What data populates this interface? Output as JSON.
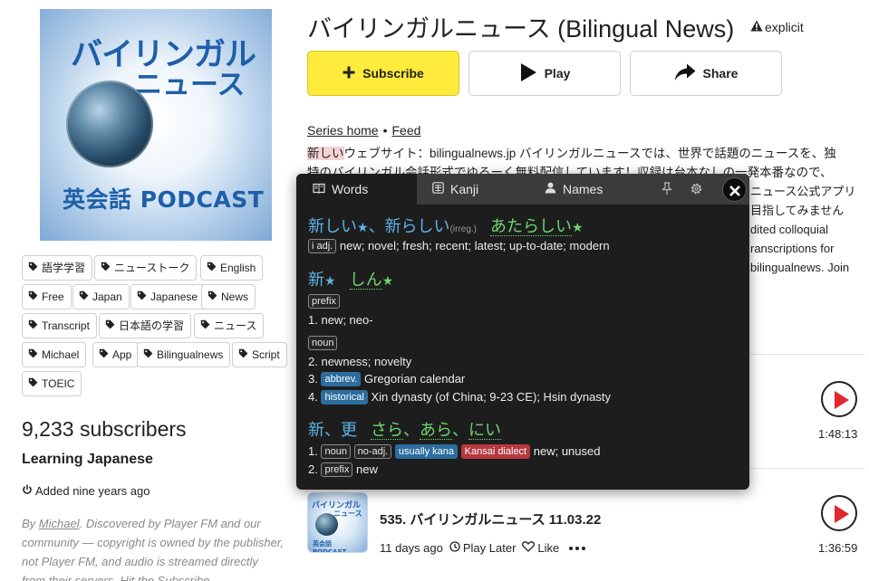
{
  "cover": {
    "line1": "バイリンガル",
    "line2": "ニュース",
    "line3": "英会話 PODCAST"
  },
  "tags": [
    "語学学習",
    "ニューストーク",
    "English",
    "Free",
    "Japan",
    "Japanese",
    "News",
    "Transcript",
    "日本語の学習",
    "ニュース",
    "Michael",
    "App",
    "Bilingualnews",
    "Script",
    "TOEIC"
  ],
  "sidebar": {
    "subscribers": "9,233 subscribers",
    "category": "Learning Japanese",
    "added": "Added nine years ago",
    "disclaimer_by": "By ",
    "disclaimer_author": "Michael",
    "disclaimer_rest": ". Discovered by Player FM and our community — copyright is owned by the publisher, not Player FM, and audio is streamed directly from their servers. Hit the Subscribe"
  },
  "header": {
    "title": "バイリンガルニュース (Bilingual News)",
    "explicit": "explicit"
  },
  "actions": {
    "subscribe": "Subscribe",
    "play": "Play",
    "share": "Share"
  },
  "links": {
    "series_home": "Series home",
    "feed": "Feed"
  },
  "description": {
    "highlight": "新しい",
    "line1_rest": "ウェブサイト：bilingualnews.jp バイリンガルニュースでは、世界で話題のニュースを、独",
    "line2": "特のバイリンガル会話形式でゆるーく無料配信しています！収録は台本なしの一発本番なので、",
    "right_lines": [
      "ニュース公式アプリ",
      "目指してみません",
      "dited colloquial",
      "ranscriptions for",
      "bilingualnews. Join"
    ]
  },
  "episodes": [
    {
      "duration": "1:48:13"
    },
    {
      "title": "535. バイリンガルニュース 11.03.22",
      "age": "11 days ago",
      "play_later": "Play Later",
      "like": "Like",
      "duration": "1:36:59",
      "thumb_line1": "バイリンガル",
      "thumb_line2": "ニュース",
      "thumb_line3": "英会話 PODCAST"
    }
  ],
  "popup": {
    "tabs": {
      "words": "Words",
      "kanji": "Kanji",
      "names": "Names"
    },
    "entry1": {
      "kanji1": "新しい",
      "kanji2": "新らしい",
      "irreg": "(irreg.)",
      "reading": "あたらしい",
      "pos": "i adj.",
      "def": "new; novel; fresh; recent; latest; up-to-date; modern"
    },
    "entry2": {
      "kanji": "新",
      "reading": "しん",
      "pos_prefix": "prefix",
      "sense1": "new; neo-",
      "pos_noun": "noun",
      "sense2": "newness; novelty",
      "abbrev": "abbrev.",
      "sense3": "Gregorian calendar",
      "historical": "historical",
      "sense4": "Xin dynasty (of China; 9-23 CE); Hsin dynasty"
    },
    "entry3": {
      "kanji1": "新",
      "kanji2": "更",
      "reading1": "さら",
      "reading2": "あら",
      "reading3": "にい",
      "pos_noun": "noun",
      "pos_noadj": "no-adj.",
      "usually_kana": "usually kana",
      "kansai": "Kansai dialect",
      "def": "new; unused",
      "prefix": "prefix",
      "sense2": "new"
    }
  },
  "colors": {
    "subscribe_bg": "#ffeb3b",
    "play_red": "#e0282f",
    "popup_bg": "#1d1d1d",
    "kanji_blue": "#5fb3e6",
    "reading_green": "#6fd46f"
  }
}
